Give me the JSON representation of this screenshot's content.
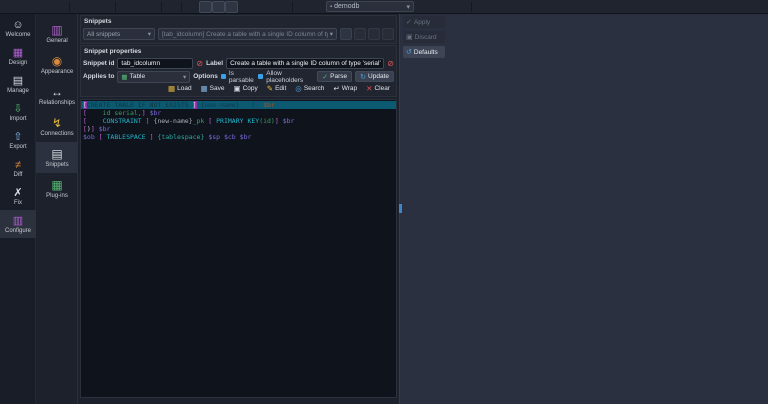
{
  "icons": {
    "chevron": "▾",
    "lock": "▪",
    "alert": "⊘",
    "table": "▦",
    "parse": "✓",
    "update": "↻",
    "apply": "✓",
    "discard": "▣",
    "defaults": "↺"
  },
  "toolbar": {
    "database_value": "demodb",
    "left_items": [
      {
        "name": "menu-icon",
        "glyph": "≡",
        "cls": "i-w big",
        "inter": true
      },
      {
        "name": "new-model-icon",
        "glyph": "▤",
        "cls": "i-w",
        "inter": true
      },
      {
        "name": "save-model-icon",
        "glyph": "▦",
        "cls": "i-b",
        "inter": true
      },
      {
        "name": "open-model-icon",
        "glyph": "▦",
        "cls": "i-y",
        "inter": true
      },
      {
        "name": "import-model-icon",
        "glyph": "▥",
        "cls": "i-w",
        "inter": true
      },
      {
        "name": "toolbar-separator",
        "glyph": "",
        "cls": "tsep",
        "inter": false
      },
      {
        "name": "print-icon",
        "glyph": "▤",
        "cls": "i-dim",
        "inter": true
      },
      {
        "name": "export-image-icon",
        "glyph": "▤",
        "cls": "i-dim",
        "inter": true
      },
      {
        "name": "export-file-icon",
        "glyph": "▤",
        "cls": "i-dim",
        "inter": true
      },
      {
        "name": "toolbar-separator",
        "glyph": "",
        "cls": "tsep",
        "inter": false
      },
      {
        "name": "zoom-out-icon",
        "glyph": "⊖",
        "cls": "i-dim",
        "inter": true
      },
      {
        "name": "zoom-reset-icon",
        "glyph": "◎",
        "cls": "i-dim",
        "inter": true
      },
      {
        "name": "zoom-in-icon",
        "glyph": "⊕",
        "cls": "i-dim",
        "inter": true
      },
      {
        "name": "toolbar-separator",
        "glyph": "",
        "cls": "tsep",
        "inter": false
      },
      {
        "name": "fit-view-icon",
        "glyph": "◎",
        "cls": "i-dim",
        "inter": true
      },
      {
        "name": "toolbar-separator",
        "glyph": "",
        "cls": "tsep",
        "inter": false
      },
      {
        "name": "flip-view-icon",
        "glyph": "▲",
        "cls": "i-dim",
        "inter": true
      },
      {
        "name": "grid-toggle-icon",
        "glyph": "▦",
        "cls": "i-w pressed",
        "inter": true
      },
      {
        "name": "snap-grid-icon",
        "glyph": "▦",
        "cls": "i-w pressed",
        "inter": true
      },
      {
        "name": "line-mode-icon",
        "glyph": "╱",
        "cls": "i-bl pressed",
        "inter": true
      },
      {
        "name": "arrange-objects-icon",
        "glyph": "▦",
        "cls": "i-dim",
        "inter": true
      },
      {
        "name": "selection-bounds-icon",
        "glyph": "▢",
        "cls": "i-dim",
        "inter": true
      },
      {
        "name": "graph-links-icon",
        "glyph": "∴",
        "cls": "i-dim",
        "inter": true
      },
      {
        "name": "layers-icon",
        "glyph": "▣",
        "cls": "i-dim",
        "inter": true
      },
      {
        "name": "toolbar-separator",
        "glyph": "",
        "cls": "tsep",
        "inter": false
      },
      {
        "name": "nav-back-icon",
        "glyph": "◀",
        "cls": "i-dim2 big",
        "inter": true
      },
      {
        "name": "nav-forward-icon",
        "glyph": "▶",
        "cls": "i-dim2 big",
        "inter": true
      }
    ],
    "right_items": [
      {
        "name": "sql-preview-icon",
        "glyph": "▤",
        "cls": "i-dim",
        "inter": true
      },
      {
        "name": "find-object-icon",
        "glyph": "◎",
        "cls": "i-bl",
        "inter": true
      },
      {
        "name": "swap-ids-icon",
        "glyph": "⇅",
        "cls": "i-g",
        "inter": true
      },
      {
        "name": "model-objects-icon",
        "glyph": "▦",
        "cls": "i-col",
        "inter": true
      },
      {
        "name": "toolbar-separator",
        "glyph": "",
        "cls": "tsep",
        "inter": false
      },
      {
        "name": "bug-report-icon",
        "glyph": "▣",
        "cls": "i-dim",
        "inter": true
      },
      {
        "name": "donate-icon",
        "glyph": "◗",
        "cls": "i-o",
        "inter": true
      },
      {
        "name": "support-icon",
        "glyph": "◉",
        "cls": "i-r",
        "inter": true
      },
      {
        "name": "search-model-icon",
        "glyph": "◎",
        "cls": "i-y",
        "inter": true
      },
      {
        "name": "changelog-icon",
        "glyph": "▤",
        "cls": "i-y",
        "inter": true
      }
    ]
  },
  "nav_sidebar": {
    "items": [
      {
        "label": "Welcome",
        "name": "sidebar-item-welcome",
        "icon": "welcome-icon",
        "glyph": "☺",
        "icls": "i-w",
        "inter": true
      },
      {
        "label": "Design",
        "name": "sidebar-item-design",
        "icon": "design-icon",
        "glyph": "▦",
        "icls": "i-col",
        "inter": true
      },
      {
        "label": "Manage",
        "name": "sidebar-item-manage",
        "icon": "manage-icon",
        "glyph": "▤",
        "icls": "i-w",
        "inter": true
      },
      {
        "label": "Import",
        "name": "sidebar-item-import",
        "icon": "import-icon",
        "glyph": "⇩",
        "icls": "i-g",
        "inter": true
      },
      {
        "label": "Export",
        "name": "sidebar-item-export",
        "icon": "export-icon",
        "glyph": "⇧",
        "icls": "i-b",
        "inter": true
      },
      {
        "label": "Diff",
        "name": "sidebar-item-diff",
        "icon": "diff-icon",
        "glyph": "≠",
        "icls": "i-o",
        "inter": true
      },
      {
        "label": "Fix",
        "name": "sidebar-item-fix",
        "icon": "fix-icon",
        "glyph": "✗",
        "icls": "i-w",
        "inter": true
      },
      {
        "label": "Configure",
        "name": "sidebar-item-configure",
        "icon": "configure-icon",
        "glyph": "▥",
        "icls": "i-col",
        "cls": "sel",
        "inter": true
      }
    ]
  },
  "config_sidebar": {
    "items": [
      {
        "label": "General",
        "name": "config-item-general",
        "icon": "general-icon",
        "glyph": "▥",
        "icls": "i-col",
        "inter": true
      },
      {
        "label": "Appearance",
        "name": "config-item-appearance",
        "icon": "appearance-icon",
        "glyph": "◉",
        "icls": "i-o",
        "inter": true
      },
      {
        "label": "Relationships",
        "name": "config-item-relationships",
        "icon": "relationships-icon",
        "glyph": "↔",
        "icls": "i-w",
        "inter": true
      },
      {
        "label": "Connections",
        "name": "config-item-connections",
        "icon": "connections-icon",
        "glyph": "↯",
        "icls": "i-y",
        "inter": true
      },
      {
        "label": "Snippets",
        "name": "config-item-snippets",
        "icon": "snippets-icon",
        "glyph": "▤",
        "icls": "i-w",
        "cls": "sel",
        "inter": true
      },
      {
        "label": "Plug-ins",
        "name": "config-item-plugins",
        "icon": "plugins-icon",
        "glyph": "▦",
        "icls": "i-g",
        "inter": true
      }
    ]
  },
  "snippets_box": {
    "title": "Snippets",
    "filter_value": "All snippets",
    "selected_snippet": "[tab_idcolumn] Create a table with a single ID column of type 'serial'",
    "buttons": [
      {
        "name": "remove-all-snippets-button",
        "glyph": "⊘",
        "cls": "i-redring",
        "inter": true
      },
      {
        "name": "edit-snippet-button",
        "glyph": "✎",
        "cls": "dim i-dim",
        "inter": true
      },
      {
        "name": "delete-snippet-button",
        "glyph": "▦",
        "cls": "dim i-dim",
        "inter": true
      },
      {
        "name": "add-snippet-button",
        "glyph": "▤",
        "cls": "dim i-dim",
        "inter": true
      }
    ]
  },
  "properties_box": {
    "title": "Snippet properties",
    "snippet_id_label": "Snippet id",
    "snippet_id_value": "tab_idcolumn",
    "label_label": "Label",
    "label_value": "Create a table with a single ID column of type 'serial'",
    "applies_to_label": "Applies to",
    "applies_to_value": "Table",
    "options_label": "Options",
    "option_parsable": "Is parsable",
    "option_placeholders": "Allow placeholders",
    "parse_label": "Parse",
    "update_label": "Update"
  },
  "editor_toolbar": {
    "buttons": [
      {
        "label": "Load",
        "name": "load-button",
        "glyph": "▦",
        "icls": "i-y",
        "inter": true
      },
      {
        "label": "Save",
        "name": "save-button",
        "glyph": "▦",
        "icls": "i-b",
        "inter": true
      },
      {
        "label": "Copy",
        "name": "copy-button",
        "glyph": "▣",
        "icls": "i-w",
        "inter": true
      },
      {
        "label": "Edit",
        "name": "edit-button",
        "glyph": "✎",
        "icls": "i-y",
        "inter": true
      },
      {
        "label": "Search",
        "name": "search-button",
        "glyph": "◎",
        "icls": "i-bl",
        "inter": true
      },
      {
        "label": "Wrap",
        "name": "wrap-button",
        "glyph": "↵",
        "icls": "i-w",
        "inter": true
      },
      {
        "label": "Clear",
        "name": "clear-button",
        "glyph": "✕",
        "icls": "i-r",
        "inter": true
      }
    ]
  },
  "code_editor": {
    "lines": [
      {
        "sel": true,
        "segs": [
          {
            "t": "[",
            "c": "bm"
          },
          {
            "t": "CREATE TABLE IF NOT EXISTS ",
            "c": "k1"
          },
          {
            "t": "]",
            "c": "bm"
          },
          {
            "t": " ",
            "c": "pl"
          },
          {
            "t": "{new-name}",
            "c": "n1"
          },
          {
            "t": " ",
            "c": "pl"
          },
          {
            "t": "[",
            "c": "b1"
          },
          {
            "t": " (",
            "c": "n1"
          },
          {
            "t": "]",
            "c": "b1"
          },
          {
            "t": " ",
            "c": "pl"
          },
          {
            "t": "$br",
            "c": "o1"
          }
        ]
      },
      {
        "segs": [
          {
            "t": "[",
            "c": "b"
          },
          {
            "t": "    id serial,",
            "c": "g"
          },
          {
            "t": "]",
            "c": "b"
          },
          {
            "t": " ",
            "c": "pl"
          },
          {
            "t": "$br",
            "c": "v"
          }
        ]
      },
      {
        "segs": [
          {
            "t": "[",
            "c": "b"
          },
          {
            "t": "    ",
            "c": "pl"
          },
          {
            "t": "CONSTRAINT",
            "c": "k"
          },
          {
            "t": " ",
            "c": "pl"
          },
          {
            "t": "]",
            "c": "b"
          },
          {
            "t": " ",
            "c": "pl"
          },
          {
            "t": "{new-name}",
            "c": "nm"
          },
          {
            "t": "_pk",
            "c": "g"
          },
          {
            "t": " ",
            "c": "pl"
          },
          {
            "t": "[",
            "c": "b"
          },
          {
            "t": " ",
            "c": "pl"
          },
          {
            "t": "PRIMARY KEY",
            "c": "k"
          },
          {
            "t": "(id)",
            "c": "g"
          },
          {
            "t": "]",
            "c": "b"
          },
          {
            "t": " ",
            "c": "pl"
          },
          {
            "t": "$br",
            "c": "v"
          }
        ]
      },
      {
        "segs": [
          {
            "t": "[",
            "c": "b"
          },
          {
            "t": ")",
            "c": "pl"
          },
          {
            "t": "]",
            "c": "b"
          },
          {
            "t": " ",
            "c": "pl"
          },
          {
            "t": "$br",
            "c": "v"
          }
        ]
      },
      {
        "segs": [
          {
            "t": "$ob",
            "c": "v"
          },
          {
            "t": " ",
            "c": "pl"
          },
          {
            "t": "[",
            "c": "b"
          },
          {
            "t": " ",
            "c": "pl"
          },
          {
            "t": "TABLESPACE",
            "c": "k"
          },
          {
            "t": " ",
            "c": "pl"
          },
          {
            "t": "]",
            "c": "b"
          },
          {
            "t": " ",
            "c": "pl"
          },
          {
            "t": "{tablespace}",
            "c": "tb"
          },
          {
            "t": " ",
            "c": "pl"
          },
          {
            "t": "$sp",
            "c": "v"
          },
          {
            "t": " ",
            "c": "pl"
          },
          {
            "t": "$cb",
            "c": "v"
          },
          {
            "t": " ",
            "c": "pl"
          },
          {
            "t": "$br",
            "c": "v"
          }
        ]
      }
    ]
  },
  "side_panel": {
    "apply_label": "Apply",
    "discard_label": "Discard",
    "defaults_label": "Defaults"
  },
  "colors": {
    "accent_blue": "#3aa0e8",
    "alert_red": "#e05555",
    "selection_teal": "#0c5a72",
    "keyword_cyan": "#21b8cc",
    "bracket_magenta": "#c75fd6",
    "token_purple": "#7e6bd9",
    "identifier_green": "#3f9e63"
  }
}
